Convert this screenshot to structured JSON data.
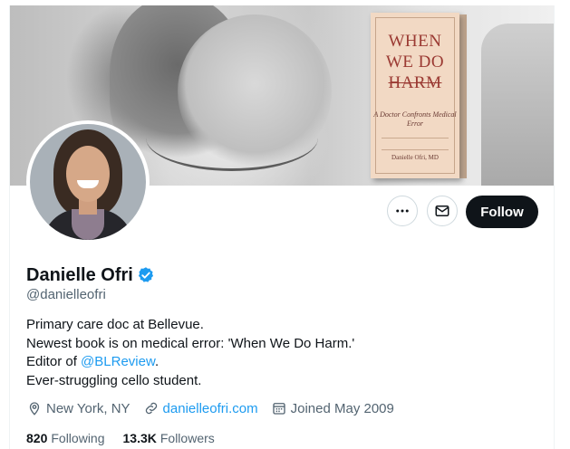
{
  "banner": {
    "book": {
      "title_line1": "WHEN",
      "title_line2": "WE DO",
      "title_line3": "HARM",
      "subtitle": "A Doctor Confronts Medical Error",
      "author": "Danielle Ofri, MD"
    }
  },
  "profile": {
    "name": "Danielle Ofri",
    "handle": "@danielleofri",
    "verified": true
  },
  "actions": {
    "more_icon": "more-horizontal-icon",
    "message_icon": "envelope-icon",
    "follow_label": "Follow"
  },
  "bio": {
    "line1": "Primary care doc at Bellevue.",
    "line2": "Newest book is on medical error: 'When We Do Harm.'",
    "line3_prefix": "Editor of ",
    "line3_link": "@BLReview",
    "line3_suffix": ".",
    "line4": "Ever-struggling cello student."
  },
  "meta": {
    "location": "New York, NY",
    "website": "danielleofri.com",
    "joined": "Joined May 2009"
  },
  "stats": {
    "following_count": "820",
    "following_label": "Following",
    "followers_count": "13.3K",
    "followers_label": "Followers"
  },
  "colors": {
    "accent": "#1d9bf0",
    "text_primary": "#0f1419",
    "text_secondary": "#536471",
    "follow_bg": "#0f1419"
  }
}
